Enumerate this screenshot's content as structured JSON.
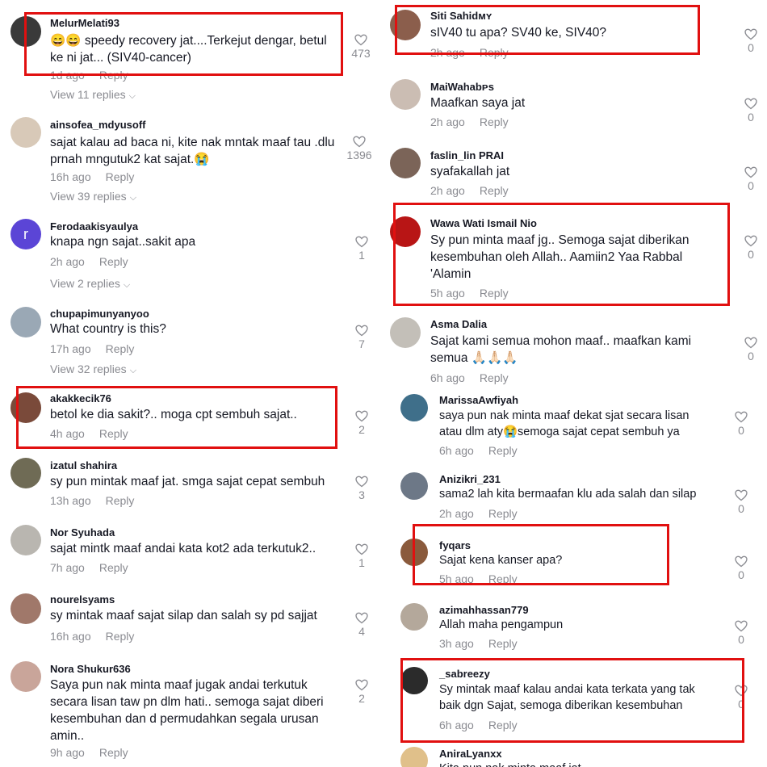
{
  "left_comments": [
    {
      "user": "MelurMelati93",
      "text": "😄😄 speedy recovery jat....Terkejut dengar, betul ke ni jat... (SIV40-cancer)",
      "time": "1d ago",
      "reply": "Reply",
      "likes": "473",
      "view": "View 11 replies"
    },
    {
      "user": "ainsofea_mdyusoff",
      "text": "sajat kalau ad baca ni, kite nak mntak maaf tau .dlu prnah mngutuk2 kat sajat.😭",
      "time": "16h ago",
      "reply": "Reply",
      "likes": "1396",
      "view": "View 39 replies"
    },
    {
      "user": "Ferodaakisyaulya",
      "avatar_letter": "r",
      "text": "knapa ngn sajat..sakit apa",
      "time": "2h ago",
      "reply": "Reply",
      "likes": "1",
      "view": "View 2 replies"
    },
    {
      "user": "chupapimunyanyoo",
      "text": "What country is this?",
      "time": "17h ago",
      "reply": "Reply",
      "likes": "7",
      "view": "View 32 replies"
    },
    {
      "user": "akakkecik76",
      "text": "betol ke dia sakit?.. moga cpt sembuh sajat..",
      "time": "4h ago",
      "reply": "Reply",
      "likes": "2"
    },
    {
      "user": "izatul shahira",
      "text": "sy pun mintak maaf jat. smga sajat cepat sembuh",
      "time": "13h ago",
      "reply": "Reply",
      "likes": "3"
    },
    {
      "user": "Nor Syuhada",
      "text": "sajat mintk maaf andai kata kot2 ada terkutuk2..",
      "time": "7h ago",
      "reply": "Reply",
      "likes": "1"
    },
    {
      "user": "nourelsyams",
      "text": "sy mintak maaf sajat silap dan salah sy pd sajjat",
      "time": "16h ago",
      "reply": "Reply",
      "likes": "4"
    },
    {
      "user": "Nora Shukur636",
      "text": "Saya pun nak minta maaf jugak andai terkutuk secara lisan taw pn dlm hati.. semoga sajat diberi kesembuhan dan d permudahkan segala urusan amin..",
      "time": "9h ago",
      "reply": "Reply",
      "likes": "2"
    }
  ],
  "right_comments": [
    {
      "user": "Siti Sahidᴍʏ",
      "text": "sIV40 tu apa? SV40 ke, SIV40?",
      "time": "2h ago",
      "reply": "Reply",
      "likes": "0"
    },
    {
      "user": "MaiWahabᴘs",
      "text": "Maafkan saya jat",
      "time": "2h ago",
      "reply": "Reply",
      "likes": "0"
    },
    {
      "user": "faslin_lin PRAI",
      "text": "syafakallah jat",
      "time": "2h ago",
      "reply": "Reply",
      "likes": "0"
    },
    {
      "user": "Wawa Wati Ismail Nio",
      "text": "Sy pun minta maaf jg.. Semoga sajat diberikan kesembuhan oleh Allah.. Aamiin2 Yaa Rabbal 'Alamin",
      "time": "5h ago",
      "reply": "Reply",
      "likes": "0"
    },
    {
      "user": "Asma Dalia",
      "text": "Sajat kami semua mohon maaf.. maafkan kami semua 🙏🏻🙏🏻🙏🏻",
      "time": "6h ago",
      "reply": "Reply",
      "likes": "0"
    },
    {
      "user": "MarissaAwfiyah",
      "text": "saya pun nak minta maaf dekat sjat secara lisan atau dlm aty😭semoga sajat cepat sembuh ya",
      "time": "6h ago",
      "reply": "Reply",
      "likes": "0"
    },
    {
      "user": "Anizikri_231",
      "text": "sama2 lah kita bermaafan klu ada salah dan silap",
      "time": "2h ago",
      "reply": "Reply",
      "likes": "0"
    },
    {
      "user": "fyqars",
      "text": "Sajat kena kanser apa?",
      "time": "5h ago",
      "reply": "Reply",
      "likes": "0"
    },
    {
      "user": "azimahhassan779",
      "text": "Allah maha pengampun",
      "time": "3h ago",
      "reply": "Reply",
      "likes": "0"
    },
    {
      "user": "_sabreezy",
      "text": "Sy mintak maaf kalau andai kata terkata yang tak baik dgn Sajat, semoga diberikan kesembuhan",
      "time": "6h ago",
      "reply": "Reply",
      "likes": "0"
    },
    {
      "user": "AniraLyanxx",
      "text": "Kita pun nak minta maaf jat",
      "time": "",
      "reply": "",
      "likes": ""
    }
  ],
  "colors": {
    "highlight": "#e11010",
    "muted": "#8a8b91",
    "text": "#161823"
  }
}
